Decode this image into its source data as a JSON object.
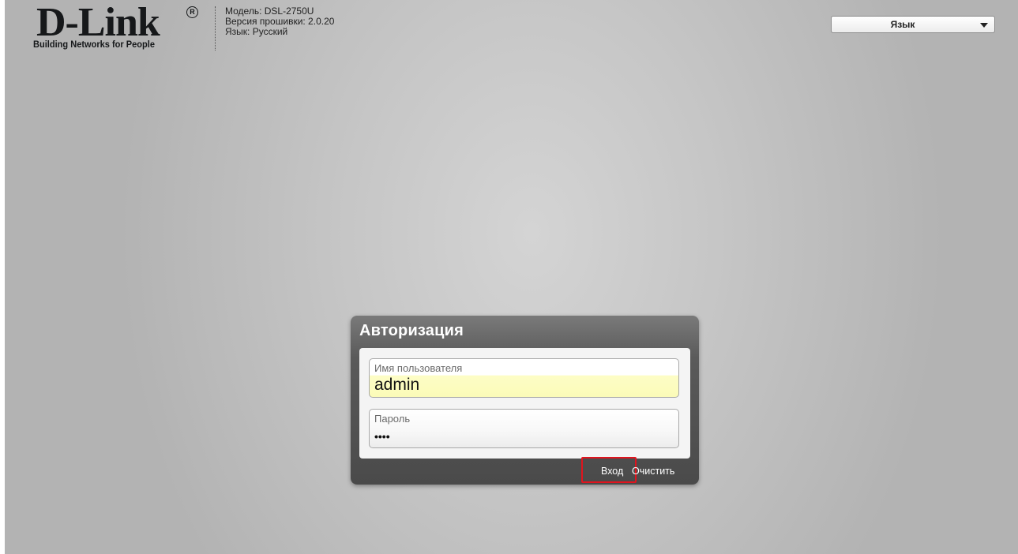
{
  "header": {
    "logo_word": "D-Link",
    "logo_reg": "R",
    "logo_tagline": "Building Networks for People",
    "model_line": "Модель: DSL-2750U",
    "firmware_line": "Версия прошивки:  2.0.20",
    "language_line": "Язык: Русский"
  },
  "language_select": {
    "label": "Язык",
    "icon": "chevron-down-icon"
  },
  "login": {
    "title": "Авторизация",
    "username_label": "Имя пользователя",
    "username_value": "admin",
    "password_label": "Пароль",
    "password_value": "••••",
    "login_button": "Вход",
    "clear_button": "Очистить"
  },
  "colors": {
    "highlight": "#e0141e",
    "autofill": "#fbfbb8"
  }
}
